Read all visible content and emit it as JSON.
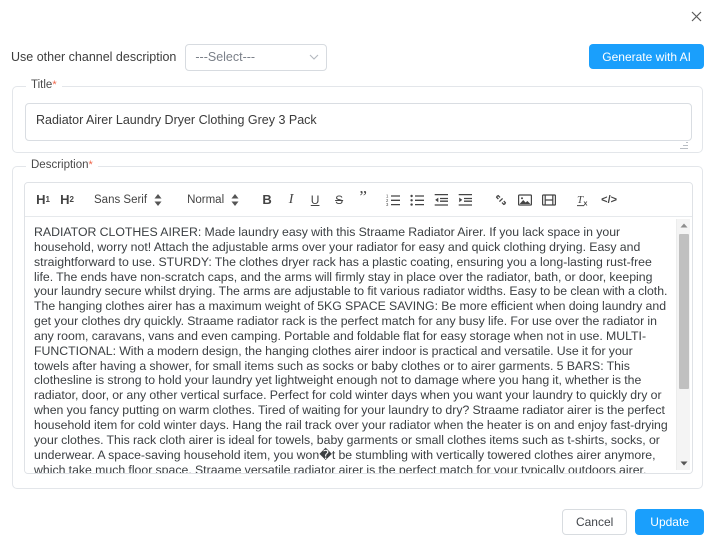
{
  "dialog": {
    "close_label": "×"
  },
  "channel": {
    "label": "Use other channel description",
    "select_value": "---Select---",
    "caret_icon": "chevron-down-icon"
  },
  "generate": {
    "label": "Generate with AI",
    "color": "#1a9ffc"
  },
  "title_field": {
    "label": "Title",
    "required_mark": "*",
    "value": "Radiator Airer Laundry Dryer Clothing Grey 3 Pack",
    "placeholder": "Title"
  },
  "description_field": {
    "label": "Description",
    "required_mark": "*",
    "toolbar": {
      "h1_label": "H",
      "h1_sub": "1",
      "h2_label": "H",
      "h2_sub": "2",
      "font_family": "Sans Serif",
      "font_size": "Normal",
      "bold_label": "B",
      "italic_label": "I",
      "underline_label": "U",
      "strike_label": "S",
      "quote_label": "”",
      "clear_format_label": "Tx",
      "code_label": "</>",
      "icons": [
        "heading-1-icon",
        "heading-2-icon",
        "font-family-select",
        "font-size-select",
        "bold-icon",
        "italic-icon",
        "underline-icon",
        "strikethrough-icon",
        "blockquote-icon",
        "ordered-list-icon",
        "bullet-list-icon",
        "outdent-icon",
        "indent-icon",
        "link-icon",
        "image-icon",
        "video-icon",
        "clear-formatting-icon",
        "code-icon"
      ]
    },
    "body_text": "RADIATOR CLOTHES AIRER: Made laundry easy with this Straame Radiator Airer. If you lack space in your household, worry not! Attach the adjustable arms over your radiator for easy and quick clothing drying. Easy and straightforward to use. STURDY: The clothes dryer rack has a plastic coating, ensuring you a long-lasting rust-free life. The ends have non-scratch caps, and the arms will firmly stay in place over the radiator, bath, or door, keeping your laundry secure whilst drying. The arms are adjustable to fit various radiator widths. Easy to be clean with a cloth. The hanging clothes airer has a maximum weight of 5KG SPACE SAVING: Be more efficient when doing laundry and get your clothes dry quickly. Straame radiator rack is the perfect match for any busy life. For use over the radiator in any room, caravans, vans and even camping. Portable and foldable flat for easy storage when not in use. MULTI-FUNCTIONAL: With a modern design, the hanging clothes airer indoor is practical and versatile. Use it for your towels after having a shower, for small items such as socks or baby clothes or to airer garments. 5 BARS: This clothesline is strong to hold your laundry yet lightweight enough not to damage where you hang it, whether is the radiator, door, or any other vertical surface. Perfect for cold winter days when you want your laundry to quickly dry or when you fancy putting on warm clothes. Tired of waiting for your laundry to dry? Straame radiator airer is the perfect household item for cold winter days. Hang the rail track over your radiator when the heater is on and enjoy fast-drying your clothes. This rack cloth airer is ideal for towels, baby garments or small clothes items such as t-shirts, socks, or underwear. A space-saving household item, you won�t be stumbling with vertically towered clothes airer anymore, which take much floor space. Straame versatile radiator airer is the perfect match for your typically outdoors airer. Foldable flat for easy storage, Straame"
  },
  "footer": {
    "cancel_label": "Cancel",
    "update_label": "Update",
    "update_color": "#1a9ffc"
  }
}
